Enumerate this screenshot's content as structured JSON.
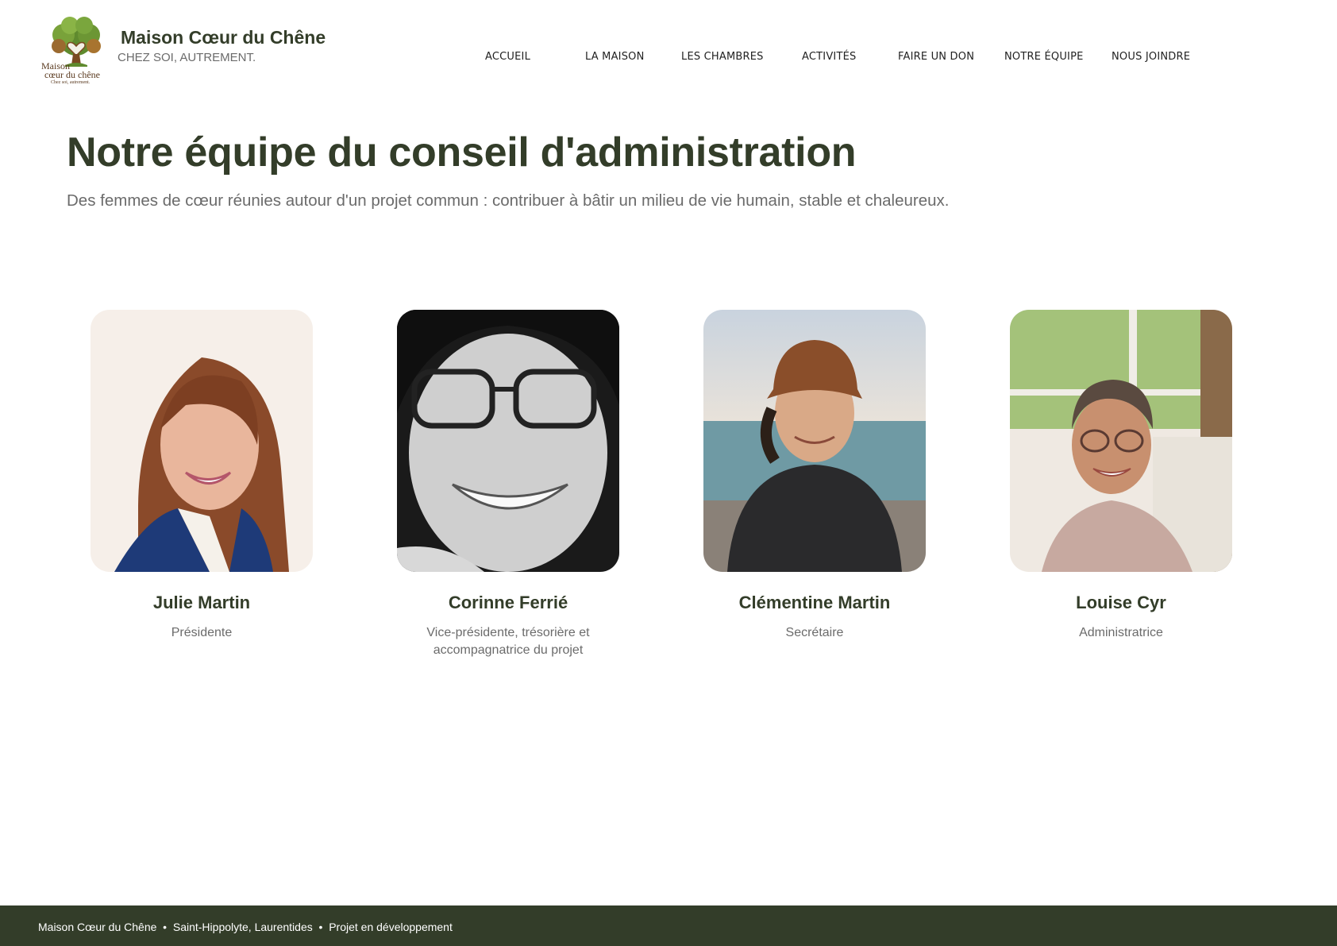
{
  "header": {
    "brand_name": "Maison Cœur du Chêne",
    "tagline": "CHEZ SOI, AUTREMENT.",
    "logo": {
      "icon": "oak-tree-heart-logo-icon",
      "line1": "Maison",
      "line2": "cœur du chêne",
      "line3": "Chez soi, autrement."
    }
  },
  "nav": {
    "items": [
      {
        "label": "ACCUEIL"
      },
      {
        "label": "LA MAISON"
      },
      {
        "label": "LES CHAMBRES"
      },
      {
        "label": "ACTIVITÉS"
      },
      {
        "label": "FAIRE UN DON"
      },
      {
        "label": "NOTRE ÉQUIPE"
      },
      {
        "label": "NOUS JOINDRE"
      }
    ]
  },
  "hero": {
    "title": "Notre équipe du conseil d'administration",
    "subtitle": "Des femmes de cœur réunies autour d'un projet commun : contribuer à bâtir un milieu de vie humain, stable et chaleureux."
  },
  "team": {
    "members": [
      {
        "name": "Julie Martin",
        "role": "Présidente",
        "photo": "portrait-photo-julie"
      },
      {
        "name": "Corinne Ferrié",
        "role": "Vice-présidente, trésorière et accompagnatrice du projet",
        "photo": "portrait-photo-corinne"
      },
      {
        "name": "Clémentine Martin",
        "role": "Secrétaire",
        "photo": "portrait-photo-clementine"
      },
      {
        "name": "Louise Cyr",
        "role": "Administratrice",
        "photo": "portrait-photo-louise"
      }
    ]
  },
  "footer": {
    "text": "Maison Cœur du Chêne  •  Saint-Hippolyte, Laurentides  •  Projet en développement"
  },
  "colors": {
    "brand_green": "#333d29",
    "muted_text": "#6b6b6b",
    "background": "#ffffff"
  }
}
